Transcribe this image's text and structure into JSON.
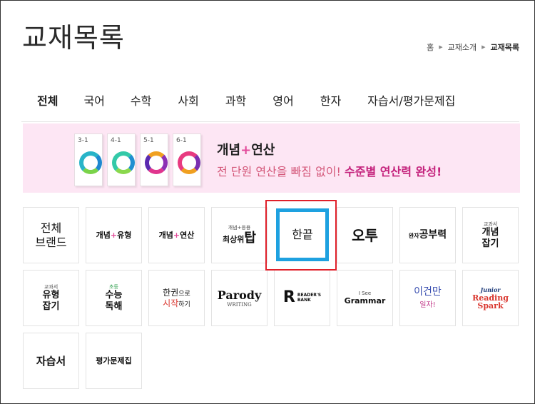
{
  "header": {
    "title": "교재목록",
    "breadcrumb": [
      "홈",
      "교재소개",
      "교재목록"
    ]
  },
  "tabs": [
    "전체",
    "국어",
    "수학",
    "사회",
    "과학",
    "영어",
    "한자",
    "자습서/평가문제집"
  ],
  "active_tab": "전체",
  "banner": {
    "logo_left": "개념",
    "logo_plus": "+",
    "logo_right": "연산",
    "line_plain": "전 단원 연산을 빠짐 없이! ",
    "line_bold": "수준별 연산력 완성!",
    "book_numbers": [
      "3-1",
      "4-1",
      "5-1",
      "6-1"
    ],
    "colors": {
      "bg": "#fde6f4",
      "accent": "#c4227c"
    }
  },
  "brands": {
    "all_line1": "전체",
    "all_line2": "브랜드",
    "gaenyeom_yuhyeong_a": "개념",
    "gaenyeom_yuhyeong_b": "+",
    "gaenyeom_yuhyeong_c": "유형",
    "gaenyeom_yeonsan_a": "개념",
    "gaenyeom_yeonsan_b": "+",
    "gaenyeom_yeonsan_c": "연산",
    "choesangwi_small": "개념+응용",
    "choesangwi": "최상위",
    "choesangwi_tap": "탑",
    "hangeul": "한끝",
    "oh_tu": "오투",
    "wanja_small": "완자",
    "wanja": "공부력",
    "gaenyeom_japgi_small": "교과서",
    "gaenyeom_japgi_1": "개념",
    "gaenyeom_japgi_2": "잡기",
    "yuhyeong_japgi_small": "교과서",
    "yuhyeong_japgi_1": "유형",
    "yuhyeong_japgi_2": "잡기",
    "suneung_small": "초등",
    "suneung_1": "수능",
    "suneung_2": "독해",
    "hangwon_1a": "한권",
    "hangwon_1b": "으로",
    "hangwon_2a": "시작",
    "hangwon_2b": "하기",
    "parody": "Parody",
    "parody_small": "WRITING",
    "readers": "READER'S",
    "readers_2": "BANK",
    "grammar_small": "I See",
    "grammar": "Grammar",
    "ikeonman_1": "이건만",
    "ikeonman_2": "일자!",
    "junior": "Junior",
    "reading": "Reading",
    "spark": "Spark",
    "jaseupseo": "자습서",
    "pyeongga": "평가문제집"
  }
}
